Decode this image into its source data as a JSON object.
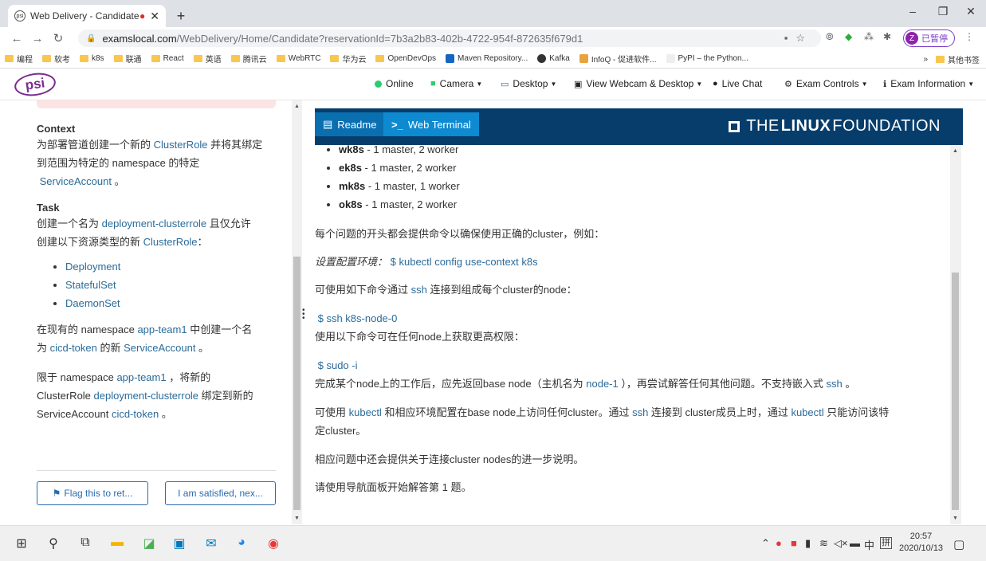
{
  "browser": {
    "tab_title": "Web Delivery - Candidate",
    "url_host": "examslocal.com",
    "url_path": "/WebDelivery/Home/Candidate?reservationId=7b3a2b83-402b-4722-954f-872635f679d1",
    "profile_status": "已暂停",
    "profile_initial": "Z",
    "bookmarks": [
      "编程",
      "软考",
      "k8s",
      "联通",
      "React",
      "英语",
      "腾讯云",
      "WebRTC",
      "华为云",
      "OpenDevOps",
      "Maven Repository...",
      "Kafka",
      "InfoQ - 促进软件...",
      "PyPI – the Python..."
    ],
    "bookmarks_more": "»",
    "bookmarks_other": "其他书签"
  },
  "psi_header": {
    "logo": "psi",
    "online": "Online",
    "camera": "Camera",
    "desktop": "Desktop",
    "view_webcam": "View Webcam & Desktop",
    "live_chat": "Live Chat",
    "exam_controls": "Exam Controls",
    "exam_information": "Exam Information"
  },
  "left_panel": {
    "context_heading": "Context",
    "context_l1_pre": "为部署管道创建一个新的 ",
    "context_l1_hl": "ClusterRole",
    "context_l1_post": " 并将其绑定",
    "context_l2": "到范围为特定的 namespace 的特定",
    "context_l3_hl": "ServiceAccount",
    "context_l3_post": " 。",
    "task_heading": "Task",
    "task_l1_pre": "创建一个名为 ",
    "task_l1_hl": "deployment-clusterrole",
    "task_l1_post": " 且仅允许",
    "task_l2_pre": "创建以下资源类型的新 ",
    "task_l2_hl": "ClusterRole",
    "task_l2_post": "：",
    "resources": [
      "Deployment",
      "StatefulSet",
      "DaemonSet"
    ],
    "p3_l1_pre": "在现有的 namespace ",
    "p3_l1_hl": "app-team1",
    "p3_l1_post": " 中创建一个名",
    "p3_l2_pre": "为 ",
    "p3_l2_hl": "cicd-token",
    "p3_l2_mid": " 的新 ",
    "p3_l2_hl2": "ServiceAccount",
    "p3_l2_post": " 。",
    "p4_l1_pre": "限于 namespace ",
    "p4_l1_hl": "app-team1",
    "p4_l1_post": " ，将新的",
    "p4_l2_pre": "ClusterRole ",
    "p4_l2_hl": "deployment-clusterrole",
    "p4_l2_post": " 绑定到新的",
    "p4_l3_pre": "ServiceAccount ",
    "p4_l3_hl": "cicd-token",
    "p4_l3_post": " 。",
    "flag_button": "Flag this to ret...",
    "satisfied_button": "I am satisfied, nex..."
  },
  "right_panel": {
    "tab_readme": "Readme",
    "tab_terminal": "Web Terminal",
    "lf_the": "THE",
    "lf_linux": "LINUX",
    "lf_foundation": "FOUNDATION",
    "clusters": [
      {
        "name": "wk8s",
        "desc": " - 1 master, 2 worker"
      },
      {
        "name": "ek8s",
        "desc": " - 1 master, 2 worker"
      },
      {
        "name": "mk8s",
        "desc": " - 1 master, 1 worker"
      },
      {
        "name": "ok8s",
        "desc": " - 1 master, 2 worker"
      }
    ],
    "p1": "每个问题的开头都会提供命令以确保使用正确的cluster，例如：",
    "p2_label": "设置配置环境：",
    "p2_code": "$ kubectl config use-context k8s",
    "p3_pre": "可使用如下命令通过 ",
    "p3_code": "ssh",
    "p3_post": " 连接到组成每个cluster的node：",
    "p4_code": "$ ssh k8s-node-0",
    "p5": "使用以下命令可在任何node上获取更高权限：",
    "p6_code": "$ sudo -i",
    "p7_pre": "完成某个node上的工作后，应先返回base node（主机名为 ",
    "p7_code": "node-1",
    "p7_mid": " ），再尝试解答任何其他问题。不支持嵌入式 ",
    "p7_code2": "ssh",
    "p7_post": " 。",
    "p8_pre": "可使用 ",
    "p8_code": "kubectl",
    "p8_mid": " 和相应环境配置在base node上访问任何cluster。通过 ",
    "p8_code2": "ssh",
    "p8_mid2": " 连接到 cluster成员上时，通过 ",
    "p8_code3": "kubectl",
    "p8_post": " 只能访问该特",
    "p8_l2": "定cluster。",
    "p9": "相应问题中还会提供关于连接cluster nodes的进一步说明。",
    "p10": "请使用导航面板开始解答第 1 题。"
  },
  "taskbar": {
    "time": "20:57",
    "date": "2020/10/13",
    "ime": "中",
    "ime2": "拼"
  }
}
